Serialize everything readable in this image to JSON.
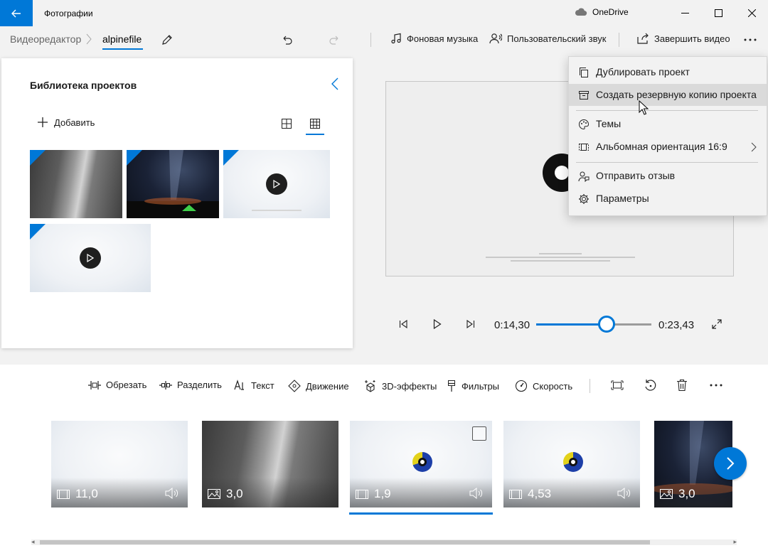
{
  "app": {
    "title": "Фотографии",
    "cloud_label": "OneDrive"
  },
  "breadcrumb": {
    "root": "Видеоредактор",
    "current": "alpinefile"
  },
  "commands": {
    "background_music": "Фоновая музыка",
    "custom_audio": "Пользовательский звук",
    "finish_video": "Завершить видео"
  },
  "library": {
    "title": "Библиотека проектов",
    "add_label": "Добавить"
  },
  "playback": {
    "current_time": "0:14,30",
    "total_time": "0:23,43",
    "progress": 0.61
  },
  "toolbar": {
    "trim": "Обрезать",
    "split": "Разделить",
    "text": "Текст",
    "motion": "Движение",
    "effects_3d": "3D-эффекты",
    "filters": "Фильтры",
    "speed": "Скорость"
  },
  "clips": [
    {
      "duration": "11,0",
      "kind": "video",
      "has_audio": true
    },
    {
      "duration": "3,0",
      "kind": "image",
      "has_audio": false
    },
    {
      "duration": "1,9",
      "kind": "video",
      "has_audio": true,
      "selected": true
    },
    {
      "duration": "4,53",
      "kind": "video",
      "has_audio": true
    },
    {
      "duration": "3,0",
      "kind": "image",
      "has_audio": false
    }
  ],
  "menu": {
    "items": [
      {
        "label": "Дублировать проект",
        "icon": "copy-icon"
      },
      {
        "label": "Создать резервную копию проекта",
        "icon": "archive-icon"
      },
      {
        "label": "Темы",
        "icon": "palette-icon"
      },
      {
        "label": "Альбомная ориентация 16:9",
        "icon": "aspect-ratio-icon"
      },
      {
        "label": "Отправить отзыв",
        "icon": "feedback-icon"
      },
      {
        "label": "Параметры",
        "icon": "gear-icon"
      }
    ]
  },
  "colors": {
    "accent": "#0078d7",
    "background": "#f2f2f2",
    "menu_hover": "#dadada"
  }
}
